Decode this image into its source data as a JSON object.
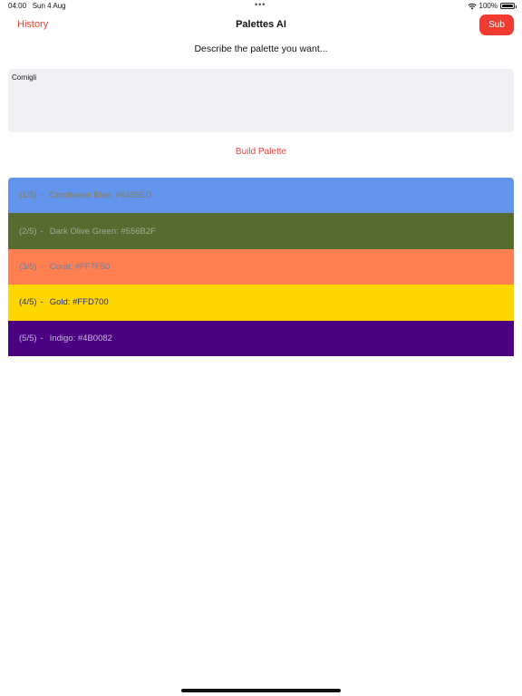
{
  "status_bar": {
    "time": "04:00",
    "date": "Sun 4 Aug",
    "dots": "•••",
    "battery": "100%"
  },
  "nav": {
    "history_label": "History",
    "title": "Palettes AI",
    "sub_label": "Sub"
  },
  "prompt": {
    "label": "Describe the palette you want...",
    "value": "Cornigli"
  },
  "build_label": "Build Palette",
  "palette": [
    {
      "index": "(1/5)",
      "sep": "-",
      "name": "Cornflower Blue: #6495ED",
      "color": "#6495ED",
      "text_color": "#8a7a56"
    },
    {
      "index": "(2/5)",
      "sep": "-",
      "name": "Dark Olive Green: #556B2F",
      "color": "#556B2F",
      "text_color": "#a4a99a"
    },
    {
      "index": "(3/5)",
      "sep": "-",
      "name": "Coral: #FF7F50",
      "color": "#FF7F50",
      "text_color": "#6a7fa8"
    },
    {
      "index": "(4/5)",
      "sep": "-",
      "name": "Gold: #FFD700",
      "color": "#FFD700",
      "text_color": "#2c2c66"
    },
    {
      "index": "(5/5)",
      "sep": "-",
      "name": "Indigo: #4B0082",
      "color": "#4B0082",
      "text_color": "#c9b8dc"
    }
  ],
  "colors": {
    "accent": "#ef4136",
    "sub_button_bg": "#f23b30",
    "input_bg": "#f1f1f5"
  }
}
